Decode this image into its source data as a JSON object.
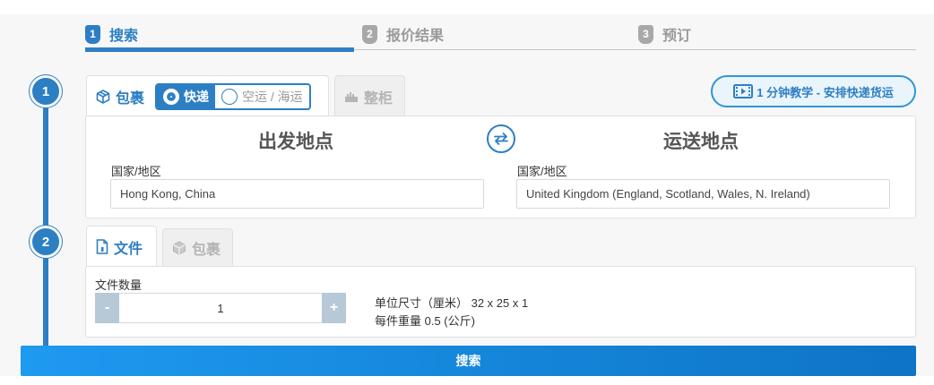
{
  "steps": [
    {
      "number": "1",
      "label": "搜索"
    },
    {
      "number": "2",
      "label": "报价结果"
    },
    {
      "number": "3",
      "label": "预订"
    }
  ],
  "timeline": [
    "1",
    "2"
  ],
  "shipment_tabs": {
    "parcel": "包裹",
    "container": "整柜",
    "mode_express": "快递",
    "mode_air_sea": "空运 / 海运"
  },
  "tutorial_button": "1 分钟教学 - 安排快递货运",
  "origin": {
    "title": "出发地点",
    "label": "国家/地区",
    "value": "Hong Kong, China"
  },
  "destination": {
    "title": "运送地点",
    "label": "国家/地区",
    "value": "United Kingdom (England, Scotland, Wales, N. Ireland)"
  },
  "package_tabs": {
    "documents": "文件",
    "parcel": "包裹"
  },
  "quantity": {
    "label": "文件数量",
    "value": "1",
    "minus": "-",
    "plus": "+"
  },
  "unit_info": {
    "dimensions": "单位尺寸（厘米） 32 x 25 x 1",
    "weight": "每件重量 0.5 (公斤)"
  },
  "search_button": "搜索",
  "colors": {
    "primary": "#2d7fc4",
    "search_gradient_start": "#1e9af0",
    "search_gradient_end": "#0e74c5"
  },
  "icons": {
    "parcel": "box-icon",
    "container": "container-icon",
    "video": "video-icon",
    "swap": "swap-arrows-icon",
    "document": "document-icon"
  }
}
